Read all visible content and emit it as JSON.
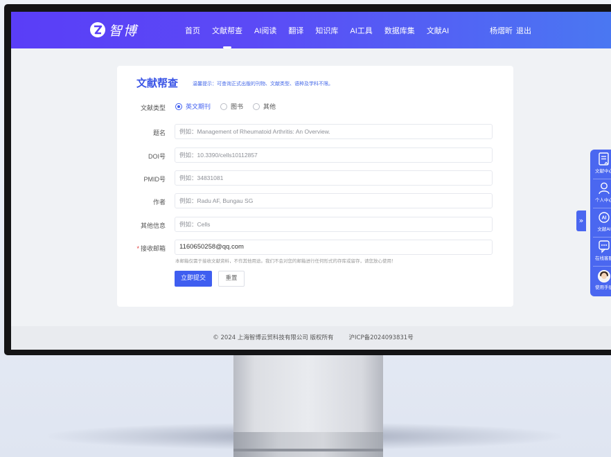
{
  "app": {
    "logo_text": "智博"
  },
  "nav": {
    "items": [
      "首页",
      "文献帮查",
      "AI阅读",
      "翻译",
      "知识库",
      "AI工具",
      "数据库集",
      "文献AI"
    ],
    "active_index": 1
  },
  "user": {
    "name": "杨熠昕",
    "logout_label": "退出"
  },
  "form": {
    "title": "文献帮查",
    "tip": "温馨提示：可查询正式出版的刊物、文献类型、语种及学科不限。",
    "doc_type": {
      "label": "文献类型",
      "options": [
        "英文期刊",
        "图书",
        "其他"
      ],
      "selected": "英文期刊"
    },
    "fields": {
      "title": {
        "label": "题名",
        "placeholder": "例如：Management of Rheumatoid Arthritis: An Overview."
      },
      "doi": {
        "label": "DOI号",
        "placeholder": "例如：10.3390/cells10112857"
      },
      "pmid": {
        "label": "PMID号",
        "placeholder": "例如：34831081"
      },
      "author": {
        "label": "作者",
        "placeholder": "例如：Radu AF, Bungau SG"
      },
      "other": {
        "label": "其他信息",
        "placeholder": "例如：Cells"
      },
      "email": {
        "label": "接收邮箱",
        "required_mark": "*",
        "value": "1160650258@qq.com"
      }
    },
    "email_note": "本邮箱仅需于接收文献资料，不作其他用途。我们不会对您的邮箱进行任何形式的存库或留存，请您放心使用！",
    "submit_label": "立即提交",
    "reset_label": "重置"
  },
  "footer": {
    "copyright": "© 2024 上海智博云贸科技有限公司 版权所有",
    "icp": "沪ICP备2024093831号"
  },
  "sidebar": {
    "toggle_glyph": "»",
    "items": [
      {
        "label": "文献中心",
        "icon": "document-icon"
      },
      {
        "label": "个人中心",
        "icon": "user-icon"
      },
      {
        "label": "文献AI",
        "icon": "ai-icon"
      },
      {
        "label": "在线客服",
        "icon": "chat-icon"
      },
      {
        "label": "使用手册",
        "icon": "avatar-icon"
      }
    ]
  },
  "colors": {
    "primary": "#3f5ef0",
    "topbar_start": "#5a3ef7",
    "topbar_end": "#4a78f2",
    "required": "#e23b3b"
  }
}
